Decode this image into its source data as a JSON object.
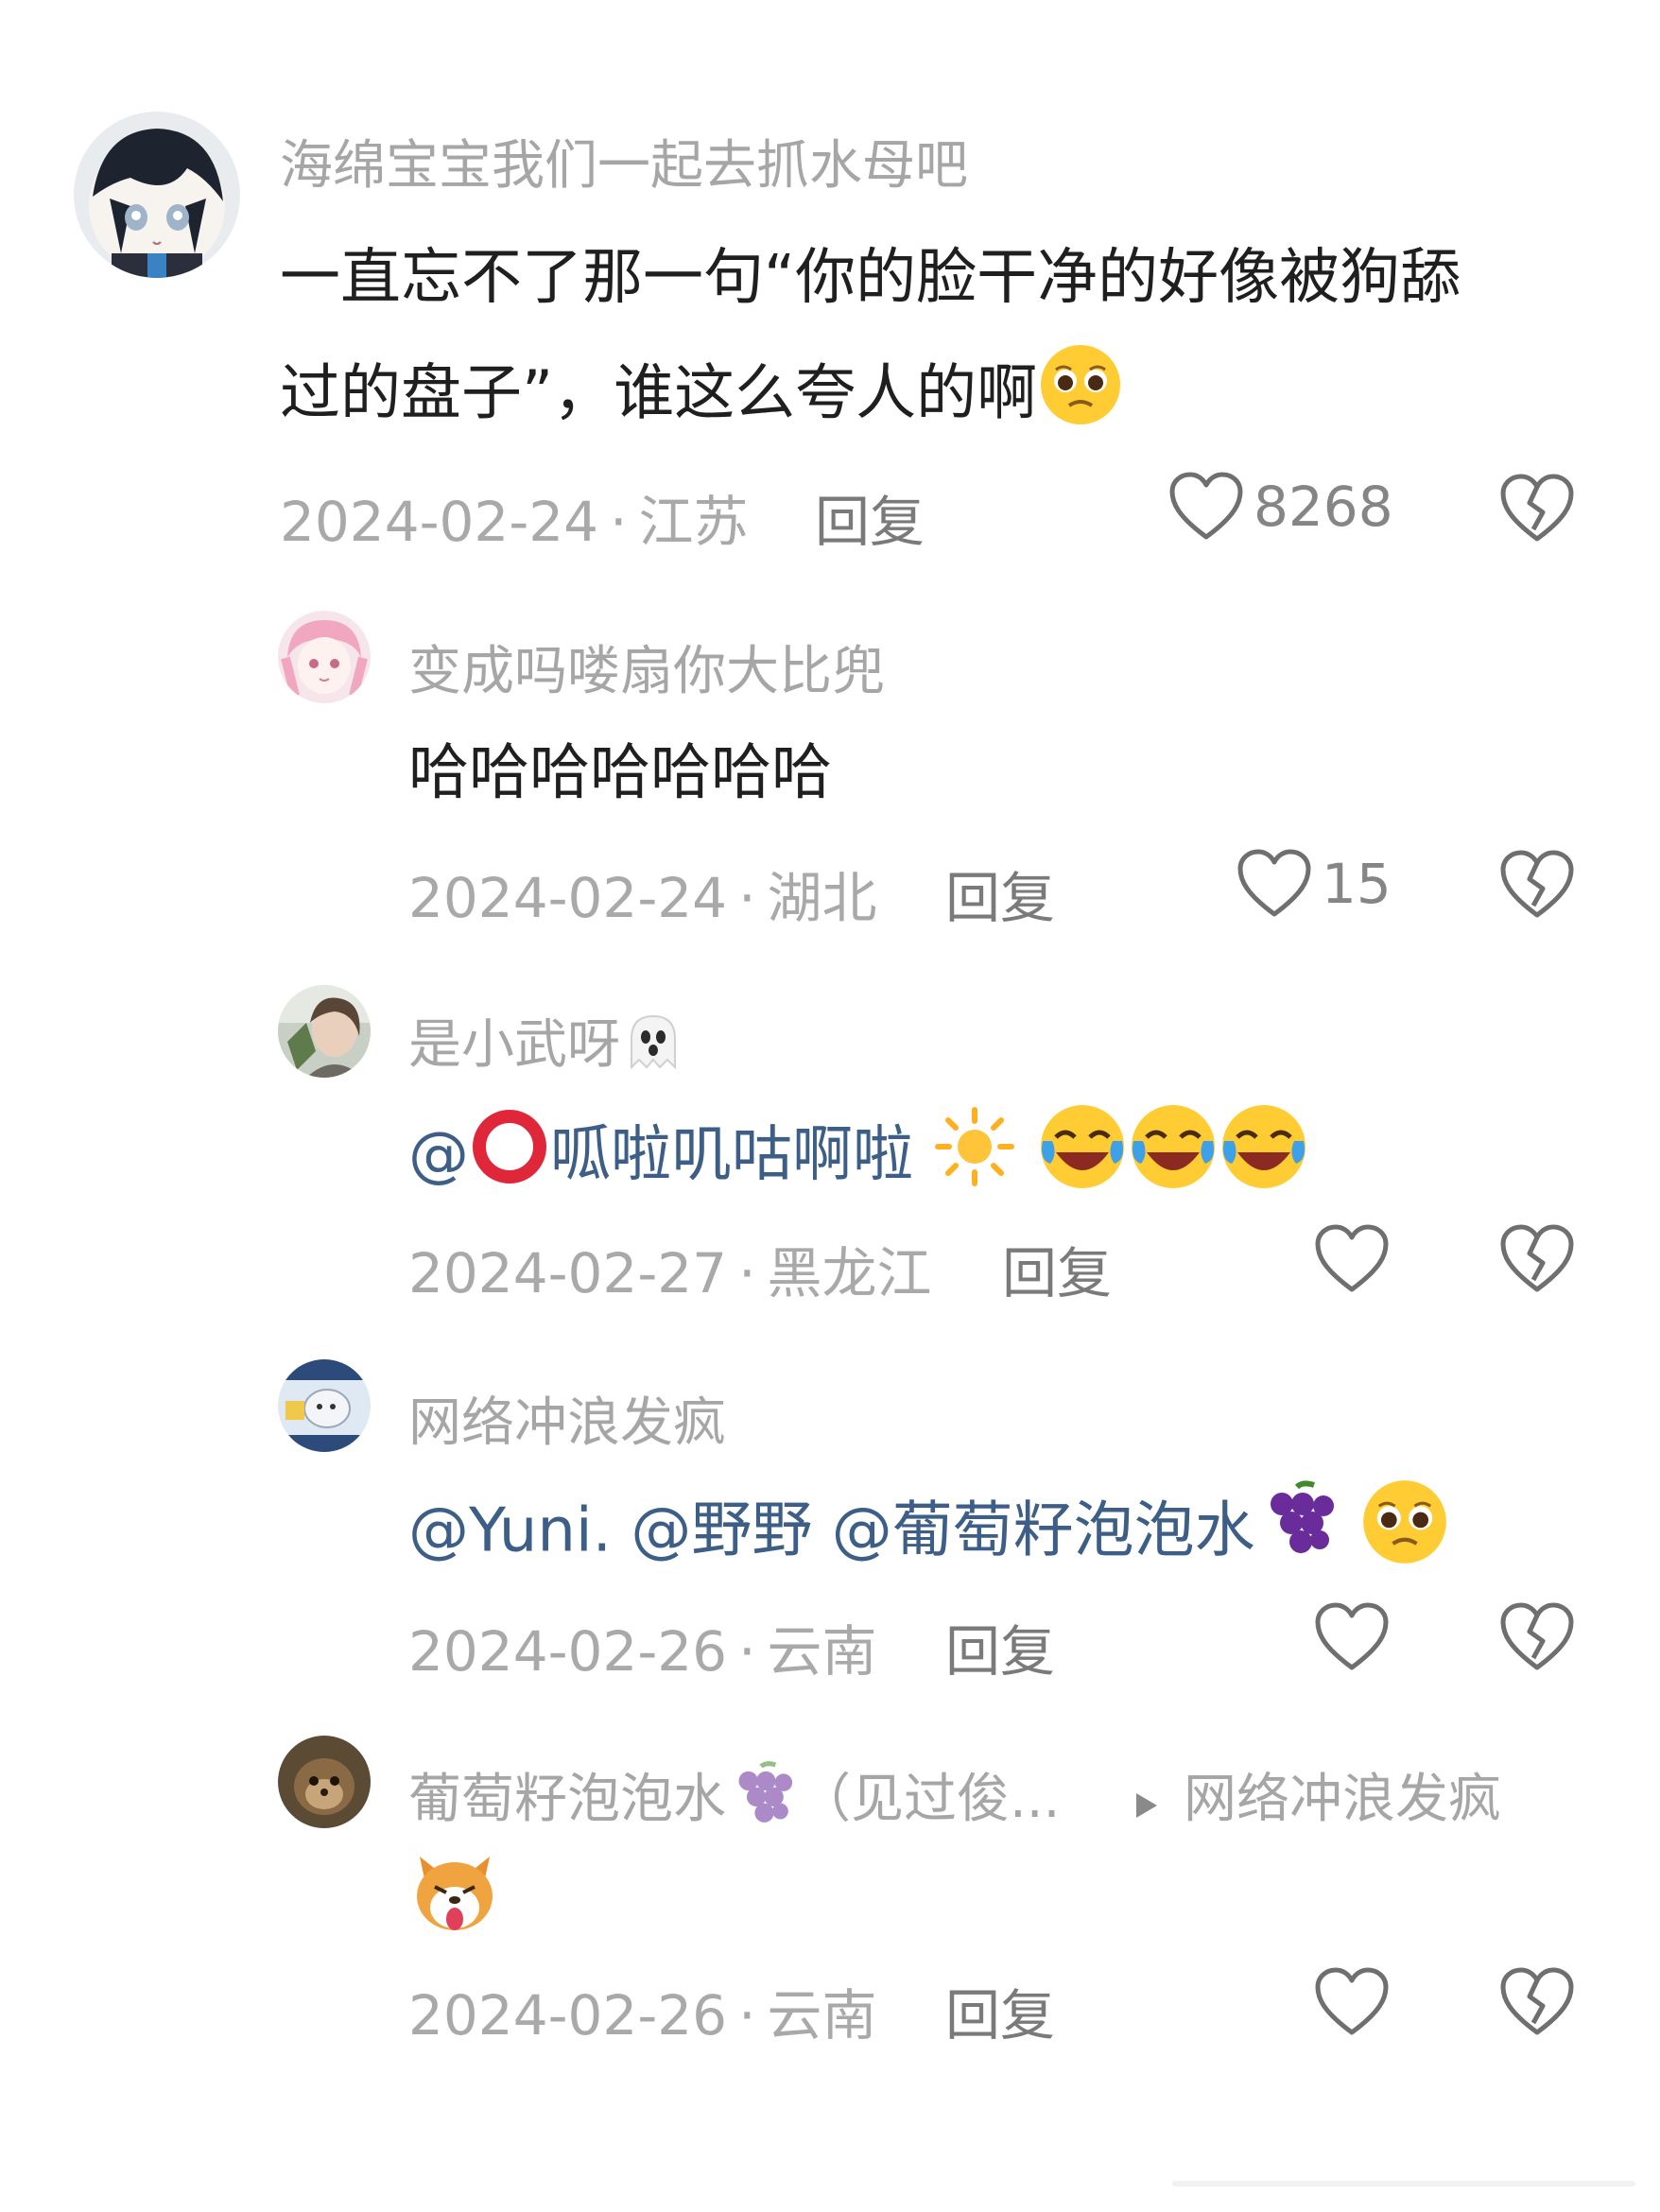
{
  "comments": [
    {
      "username": "海绵宝宝我们一起去抓水母吧",
      "text_line1": "一直忘不了那一句“你的脸干净的好像被狗舔",
      "text_line2": "过的盘子”，谁这么夸人的啊",
      "date": "2024-02-24",
      "location": "江苏",
      "reply": "回复",
      "likes": "8268"
    },
    {
      "username": "变成吗喽扇你大比兜",
      "text": "哈哈哈哈哈哈哈",
      "date": "2024-02-24",
      "location": "湖北",
      "reply": "回复",
      "likes": "15"
    },
    {
      "username": "是小武呀",
      "mention_prefix": "@",
      "mention_name": "呱啦叽咕啊啦",
      "date": "2024-02-27",
      "location": "黑龙江",
      "reply": "回复"
    },
    {
      "username": "网络冲浪发疯",
      "mentions": [
        "@Yuni.",
        "@野野",
        "@葡萄籽泡泡水"
      ],
      "date": "2024-02-26",
      "location": "云南",
      "reply": "回复"
    },
    {
      "username": "葡萄籽泡泡水",
      "username_suffix": "（见过俊...",
      "reply_target": "网络冲浪发疯",
      "date": "2024-02-26",
      "location": "云南",
      "reply": "回复"
    }
  ],
  "colors": {
    "username": "#a6a6a6",
    "text": "#1f1f1f",
    "mention": "#3d5e86",
    "meta": "#a9a9a9",
    "reply": "#7a7a7a",
    "icon": "#6f6f6f"
  },
  "icons": [
    "heart-outline-icon",
    "broken-heart-icon",
    "triangle-right-icon",
    "ghost-emoji",
    "sun-emoji",
    "laughing-crying-emoji",
    "grapes-emoji",
    "pleading-emoji",
    "shiba-dog-emoji"
  ]
}
